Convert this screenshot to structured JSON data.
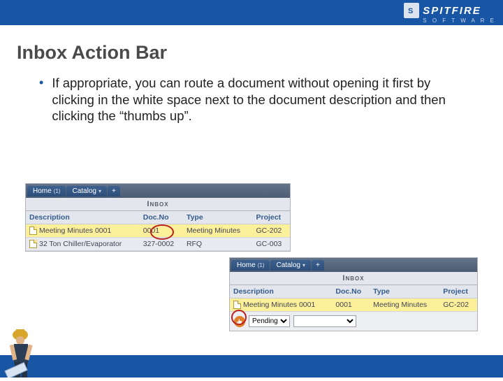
{
  "brand": {
    "name": "SPITFIRE",
    "sub": "S O F T W A R E",
    "badge": "S"
  },
  "slide": {
    "title": "Inbox Action Bar"
  },
  "bullet": {
    "text": "If appropriate, you can route a document without opening it first by clicking in the white space next to the document description and then clicking the “thumbs up”."
  },
  "tabs": {
    "home": "Home",
    "home_sup": "(1)",
    "catalog": "Catalog",
    "plus": "+"
  },
  "panel1": {
    "heading": "Inbox",
    "cols": {
      "desc": "Description",
      "docno": "Doc.No",
      "type": "Type",
      "project": "Project"
    },
    "rows": [
      {
        "desc": "Meeting Minutes 0001",
        "docno": "0001",
        "type": "Meeting Minutes",
        "project": "GC-202"
      },
      {
        "desc": "32 Ton Chiller/Evaporator",
        "docno": "327-0002",
        "type": "RFQ",
        "project": "GC-003"
      }
    ]
  },
  "panel2": {
    "heading": "Inbox",
    "cols": {
      "desc": "Description",
      "docno": "Doc.No",
      "type": "Type",
      "project": "Project"
    },
    "row": {
      "desc": "Meeting Minutes 0001",
      "docno": "0001",
      "type": "Meeting Minutes",
      "project": "GC-202"
    },
    "action": {
      "status": "Pending",
      "blank": ""
    }
  }
}
